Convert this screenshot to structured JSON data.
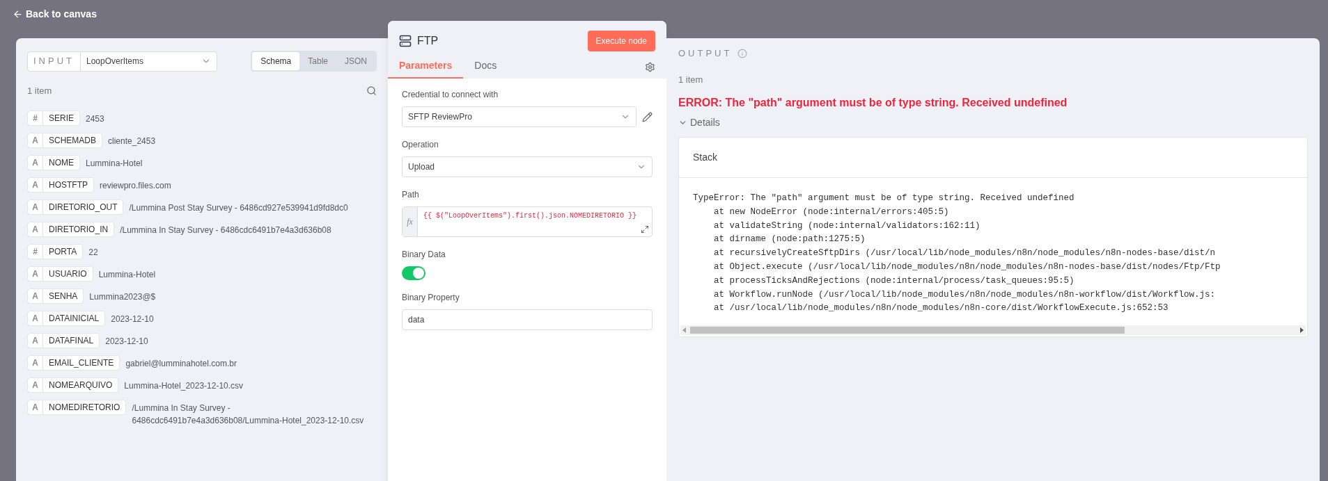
{
  "back_link": "Back to canvas",
  "input_panel": {
    "label": "INPUT",
    "node_select": "LoopOverItems",
    "view_tabs": [
      {
        "label": "Schema",
        "selected": true
      },
      {
        "label": "Table",
        "selected": false
      },
      {
        "label": "JSON",
        "selected": false
      }
    ],
    "item_count": "1 item",
    "fields": [
      {
        "type_glyph": "#",
        "key": "SERIE",
        "value": "2453"
      },
      {
        "type_glyph": "A",
        "key": "SCHEMADB",
        "value": "cliente_2453"
      },
      {
        "type_glyph": "A",
        "key": "NOME",
        "value": "Lummina-Hotel"
      },
      {
        "type_glyph": "A",
        "key": "HOSTFTP",
        "value": "reviewpro.files.com"
      },
      {
        "type_glyph": "A",
        "key": "DIRETORIO_OUT",
        "value": "/Lummina Post Stay Survey - 6486cd927e539941d9fd8dc0"
      },
      {
        "type_glyph": "A",
        "key": "DIRETORIO_IN",
        "value": "/Lummina In Stay Survey - 6486cdc6491b7e4a3d636b08"
      },
      {
        "type_glyph": "#",
        "key": "PORTA",
        "value": "22"
      },
      {
        "type_glyph": "A",
        "key": "USUARIO",
        "value": "Lummina-Hotel"
      },
      {
        "type_glyph": "A",
        "key": "SENHA",
        "value": "Lummina2023@$"
      },
      {
        "type_glyph": "A",
        "key": "DATAINICIAL",
        "value": "2023-12-10"
      },
      {
        "type_glyph": "A",
        "key": "DATAFINAL",
        "value": "2023-12-10"
      },
      {
        "type_glyph": "A",
        "key": "EMAIL_CLIENTE",
        "value": "gabriel@lumminahotel.com.br"
      },
      {
        "type_glyph": "A",
        "key": "NOMEARQUIVO",
        "value": "Lummina-Hotel_2023-12-10.csv"
      },
      {
        "type_glyph": "A",
        "key": "NOMEDIRETORIO",
        "value": "/Lummina In Stay Survey - 6486cdc6491b7e4a3d636b08/Lummina-Hotel_2023-12-10.csv"
      }
    ]
  },
  "node_panel": {
    "title": "FTP",
    "execute_button": "Execute node",
    "tabs": [
      {
        "label": "Parameters",
        "selected": true
      },
      {
        "label": "Docs",
        "selected": false
      }
    ],
    "parameters": [
      {
        "kind": "select",
        "label": "Credential to connect with",
        "value": "SFTP ReviewPro",
        "editable": true
      },
      {
        "kind": "select",
        "label": "Operation",
        "value": "Upload",
        "editable": false
      },
      {
        "kind": "expression",
        "label": "Path",
        "value": "{{ $(\"LoopOverItems\").first().json.NOMEDIRETORIO }}",
        "expression_marker": "fx"
      },
      {
        "kind": "toggle",
        "label": "Binary Data",
        "on": true
      },
      {
        "kind": "text",
        "label": "Binary Property",
        "value": "data"
      }
    ]
  },
  "output_panel": {
    "label": "OUTPUT",
    "item_count": "1 item",
    "error": "ERROR: The \"path\" argument must be of type string. Received undefined",
    "details": {
      "label": "Details",
      "expanded": true
    },
    "stack": {
      "title": "Stack",
      "lines": [
        "TypeError: The \"path\" argument must be of type string. Received undefined",
        "    at new NodeError (node:internal/errors:405:5)",
        "    at validateString (node:internal/validators:162:11)",
        "    at dirname (node:path:1275:5)",
        "    at recursivelyCreateSftpDirs (/usr/local/lib/node_modules/n8n/node_modules/n8n-nodes-base/dist/n",
        "    at Object.execute (/usr/local/lib/node_modules/n8n/node_modules/n8n-nodes-base/dist/nodes/Ftp/Ftp",
        "    at processTicksAndRejections (node:internal/process/task_queues:95:5)",
        "    at Workflow.runNode (/usr/local/lib/node_modules/n8n/node_modules/n8n-workflow/dist/Workflow.js:",
        "    at /usr/local/lib/node_modules/n8n/node_modules/n8n-core/dist/WorkflowExecute.js:652:53"
      ]
    }
  }
}
